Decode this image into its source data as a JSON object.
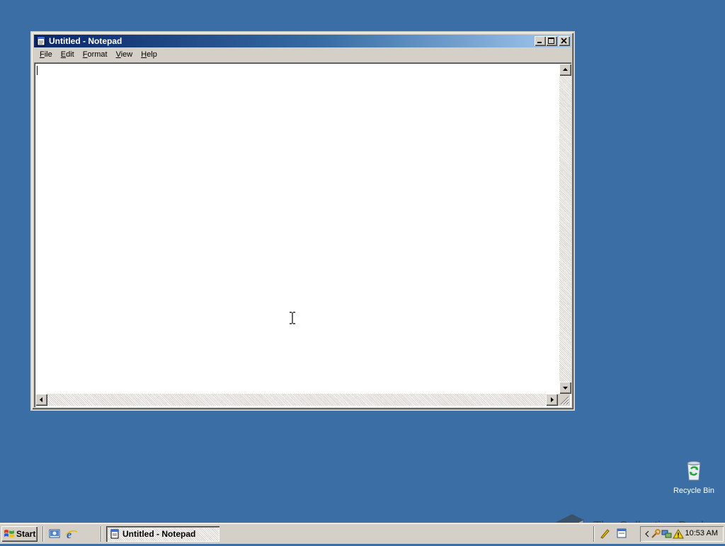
{
  "window": {
    "title": "Untitled - Notepad",
    "menus": [
      {
        "first": "F",
        "rest": "ile"
      },
      {
        "first": "E",
        "rest": "dit"
      },
      {
        "first": "F",
        "rest": "ormat"
      },
      {
        "first": "V",
        "rest": "iew"
      },
      {
        "first": "H",
        "rest": "elp"
      }
    ],
    "content": ""
  },
  "desktop": {
    "recycle_bin_label": "Recycle Bin",
    "background_color": "#3b6ea5"
  },
  "taskbar": {
    "start_label": "Start",
    "task_label": "Untitled - Notepad",
    "clock": "10:53 AM",
    "quick_launch_icons": [
      "show-desktop-icon",
      "internet-explorer-icon"
    ],
    "tray_icons": [
      "notepad-tray-icon",
      "network-icon",
      "security-warning-icon"
    ]
  },
  "watermark": {
    "text": "The Collection Book"
  }
}
